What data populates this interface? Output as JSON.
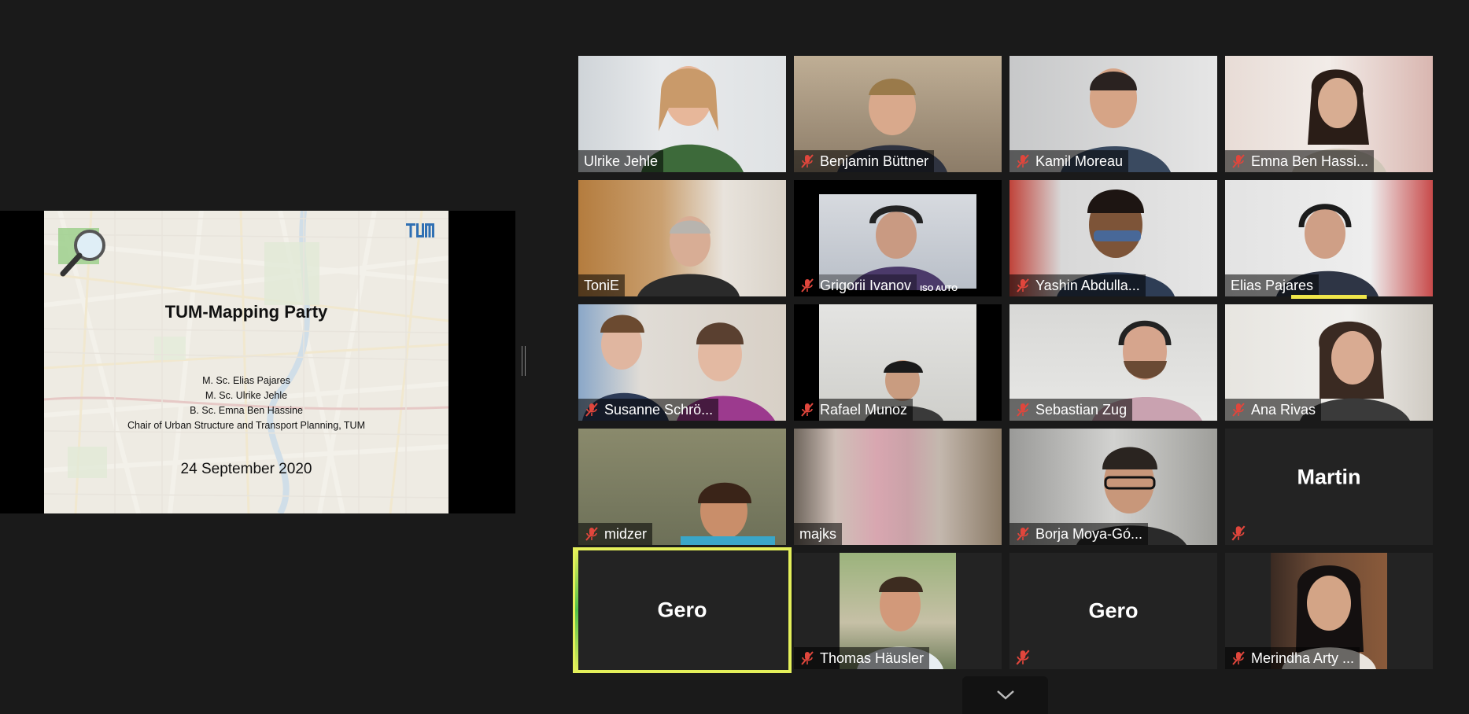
{
  "slide": {
    "title": "TUM-Mapping Party",
    "authors": [
      "M. Sc. Elias Pajares",
      "M. Sc. Ulrike Jehle",
      "B. Sc. Emna Ben Hassine",
      "Chair of Urban Structure and Transport Planning, TUM"
    ],
    "date": "24 September 2020"
  },
  "participants": [
    {
      "name": "Ulrike Jehle",
      "muted": false
    },
    {
      "name": "Benjamin Büttner",
      "muted": true
    },
    {
      "name": "Kamil Moreau",
      "muted": true
    },
    {
      "name": "Emna Ben Hassi...",
      "muted": true
    },
    {
      "name": "ToniE",
      "muted": false
    },
    {
      "name": "Grigorii Ivanov",
      "muted": true,
      "overlay": "ISO AUTO"
    },
    {
      "name": "Yashin Abdulla...",
      "muted": true
    },
    {
      "name": "Elias Pajares",
      "muted": false
    },
    {
      "name": "Susanne Schrö...",
      "muted": true
    },
    {
      "name": "Rafael Munoz",
      "muted": true
    },
    {
      "name": "Sebastian Zug",
      "muted": true
    },
    {
      "name": "Ana Rivas",
      "muted": true
    },
    {
      "name": "midzer",
      "muted": true
    },
    {
      "name": "majks",
      "muted": false
    },
    {
      "name": "Borja Moya-Gó...",
      "muted": true
    },
    {
      "name": "Martin",
      "muted": true,
      "video": false
    },
    {
      "name": "Gero",
      "muted": false,
      "video": false,
      "active_speaker": true
    },
    {
      "name": "Thomas Häusler",
      "muted": true
    },
    {
      "name": "Gero",
      "muted": true,
      "video": false
    },
    {
      "name": "Merindha Arty ...",
      "muted": true
    }
  ],
  "colors": {
    "background": "#1a1a1a",
    "active_speaker": "#e4f05a",
    "mute": "#e0463c"
  }
}
